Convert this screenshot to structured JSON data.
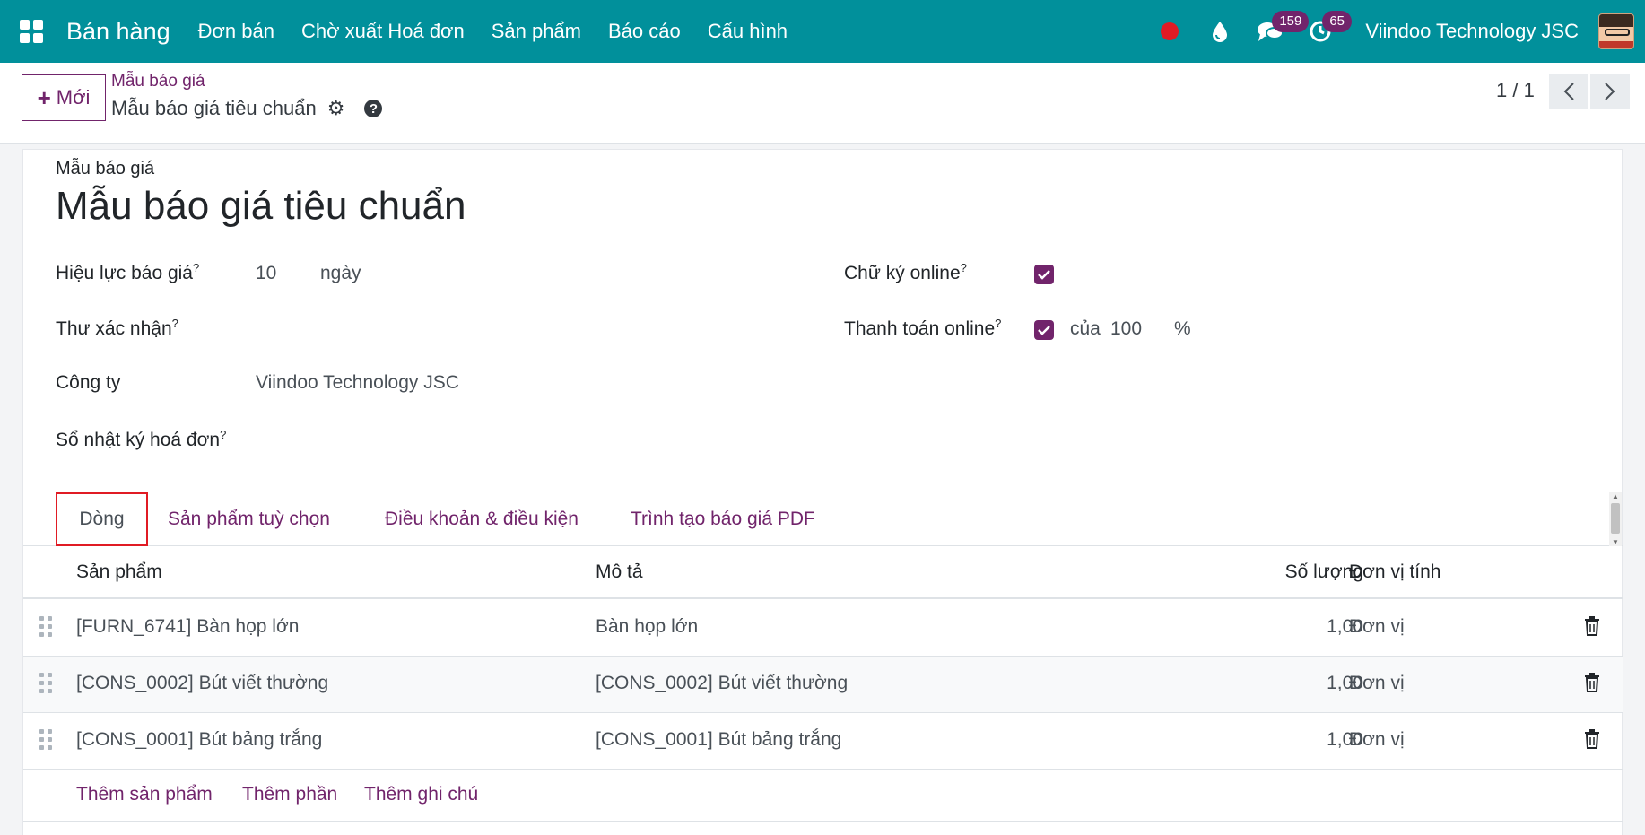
{
  "navbar": {
    "app_title": "Bán hàng",
    "menu": [
      "Đơn bán",
      "Chờ xuất Hoá đơn",
      "Sản phẩm",
      "Báo cáo",
      "Cấu hình"
    ],
    "messages_count": "159",
    "activities_count": "65",
    "company": "Viindoo Technology JSC",
    "colors": {
      "navbar_bg": "#01909b",
      "badge_bg": "#71246b",
      "record_dot": "#e01b24"
    },
    "icons": [
      "apps-icon",
      "record-dot-icon",
      "droplet-icon",
      "chat-icon",
      "clock-icon",
      "user-avatar"
    ]
  },
  "control_panel": {
    "new_button": "Mới",
    "breadcrumb": "Mẫu báo giá",
    "record_name": "Mẫu báo giá tiêu chuẩn",
    "pager": "1 / 1",
    "icons": [
      "gear-icon",
      "help-icon",
      "chevron-left-icon",
      "chevron-right-icon"
    ]
  },
  "form": {
    "model_label": "Mẫu báo giá",
    "title": "Mẫu báo giá tiêu chuẩn",
    "fields": {
      "validity_label": "Hiệu lực báo giá",
      "validity_value": "10",
      "validity_unit": "ngày",
      "confirm_mail_label": "Thư xác nhận",
      "company_label": "Công ty",
      "company_value": "Viindoo Technology JSC",
      "journal_label": "Sổ nhật ký hoá đơn",
      "online_signature_label": "Chữ ký online",
      "online_signature_checked": true,
      "online_payment_label": "Thanh toán online",
      "online_payment_checked": true,
      "payment_of": "của",
      "payment_percent": "100",
      "percent_sign": "%",
      "tooltip_mark": "?"
    }
  },
  "tabs": [
    "Dòng",
    "Sản phẩm tuỳ chọn",
    "Điều khoản & điều kiện",
    "Trình tạo báo giá PDF"
  ],
  "table": {
    "columns": [
      "Sản phẩm",
      "Mô tả",
      "Số lượng",
      "Đơn vị tính"
    ],
    "rows": [
      {
        "product": "[FURN_6741] Bàn họp lớn",
        "description": "Bàn họp lớn",
        "quantity": "1,00",
        "uom": "Đơn vị"
      },
      {
        "product": "[CONS_0002] Bút viết thường",
        "description": "[CONS_0002] Bút viết thường",
        "quantity": "1,00",
        "uom": "Đơn vị"
      },
      {
        "product": "[CONS_0001] Bút bảng trắng",
        "description": "[CONS_0001] Bút bảng trắng",
        "quantity": "1,00",
        "uom": "Đơn vị"
      }
    ],
    "add_links": [
      "Thêm sản phẩm",
      "Thêm phần",
      "Thêm ghi chú"
    ],
    "icons": [
      "drag-handle-icon",
      "trash-icon"
    ]
  }
}
